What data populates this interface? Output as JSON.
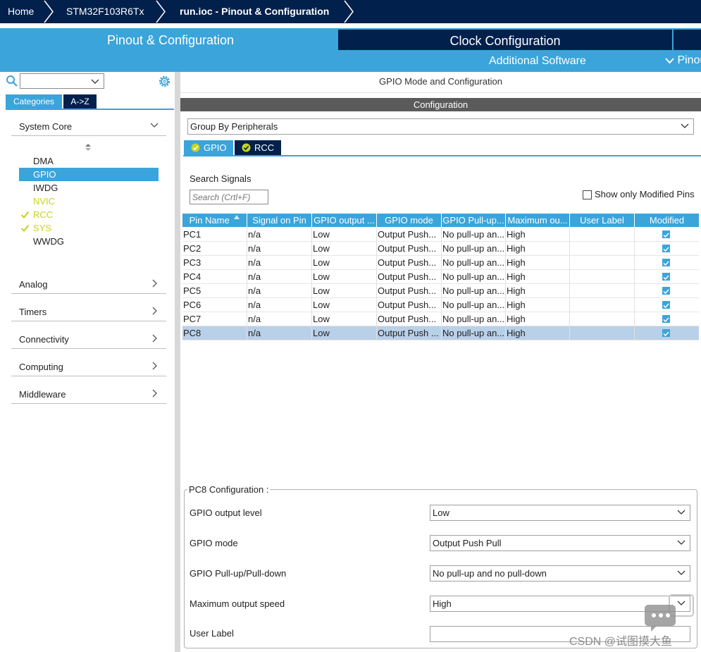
{
  "breadcrumb": [
    "Home",
    "STM32F103R6Tx",
    "run.ioc - Pinout & Configuration"
  ],
  "main_tabs": {
    "pinout": "Pinout & Configuration",
    "clock": "Clock Configuration",
    "additional_software": "Additional Software",
    "pinout_view": "Pinout"
  },
  "left": {
    "tab_categories": "Categories",
    "tab_az": "A->Z",
    "groups": [
      {
        "label": "System Core",
        "expanded": true
      },
      {
        "label": "Analog"
      },
      {
        "label": "Timers"
      },
      {
        "label": "Connectivity"
      },
      {
        "label": "Computing"
      },
      {
        "label": "Middleware"
      }
    ],
    "system_core_items": [
      {
        "label": "DMA",
        "state": "normal"
      },
      {
        "label": "GPIO",
        "state": "selected"
      },
      {
        "label": "IWDG",
        "state": "normal"
      },
      {
        "label": "NVIC",
        "state": "active"
      },
      {
        "label": "RCC",
        "state": "checked"
      },
      {
        "label": "SYS",
        "state": "checked"
      },
      {
        "label": "WWDG",
        "state": "normal"
      }
    ]
  },
  "right": {
    "mode_title": "GPIO Mode and Configuration",
    "config_title": "Configuration",
    "group_by": "Group By Peripherals",
    "tabs": [
      "GPIO",
      "RCC"
    ],
    "search_label": "Search Signals",
    "search_placeholder": "Search (Crtl+F)",
    "show_modified": "Show only Modified Pins",
    "table": {
      "headers": [
        "Pin Name",
        "Signal on Pin",
        "GPIO output ...",
        "GPIO mode",
        "GPIO Pull-up...",
        "Maximum ou...",
        "User Label",
        "Modified"
      ],
      "rows": [
        {
          "pin": "PC1",
          "signal": "n/a",
          "output": "Low",
          "mode": "Output Push...",
          "pull": "No pull-up an...",
          "speed": "High",
          "label": "",
          "modified": true
        },
        {
          "pin": "PC2",
          "signal": "n/a",
          "output": "Low",
          "mode": "Output Push...",
          "pull": "No pull-up an...",
          "speed": "High",
          "label": "",
          "modified": true
        },
        {
          "pin": "PC3",
          "signal": "n/a",
          "output": "Low",
          "mode": "Output Push...",
          "pull": "No pull-up an...",
          "speed": "High",
          "label": "",
          "modified": true
        },
        {
          "pin": "PC4",
          "signal": "n/a",
          "output": "Low",
          "mode": "Output Push...",
          "pull": "No pull-up an...",
          "speed": "High",
          "label": "",
          "modified": true
        },
        {
          "pin": "PC5",
          "signal": "n/a",
          "output": "Low",
          "mode": "Output Push...",
          "pull": "No pull-up an...",
          "speed": "High",
          "label": "",
          "modified": true
        },
        {
          "pin": "PC6",
          "signal": "n/a",
          "output": "Low",
          "mode": "Output Push...",
          "pull": "No pull-up an...",
          "speed": "High",
          "label": "",
          "modified": true
        },
        {
          "pin": "PC7",
          "signal": "n/a",
          "output": "Low",
          "mode": "Output Push...",
          "pull": "No pull-up an...",
          "speed": "High",
          "label": "",
          "modified": true
        },
        {
          "pin": "PC8",
          "signal": "n/a",
          "output": "Low",
          "mode": "Output Push ...",
          "pull": "No pull-up an...",
          "speed": "High",
          "label": "",
          "modified": true,
          "selected": true
        }
      ]
    },
    "pc8": {
      "title": "PC8 Configuration :",
      "fields": [
        {
          "label": "GPIO output level",
          "value": "Low"
        },
        {
          "label": "GPIO mode",
          "value": "Output Push Pull"
        },
        {
          "label": "GPIO Pull-up/Pull-down",
          "value": "No pull-up and no pull-down"
        },
        {
          "label": "Maximum output speed",
          "value": "High"
        },
        {
          "label": "User Label",
          "value": ""
        }
      ]
    }
  },
  "watermark": "CSDN @试图摸大鱼",
  "colors": {
    "navy": "#02204c",
    "accent": "#3ba4da",
    "active": "#c8d21e",
    "selected_row": "#b9d0e9"
  }
}
